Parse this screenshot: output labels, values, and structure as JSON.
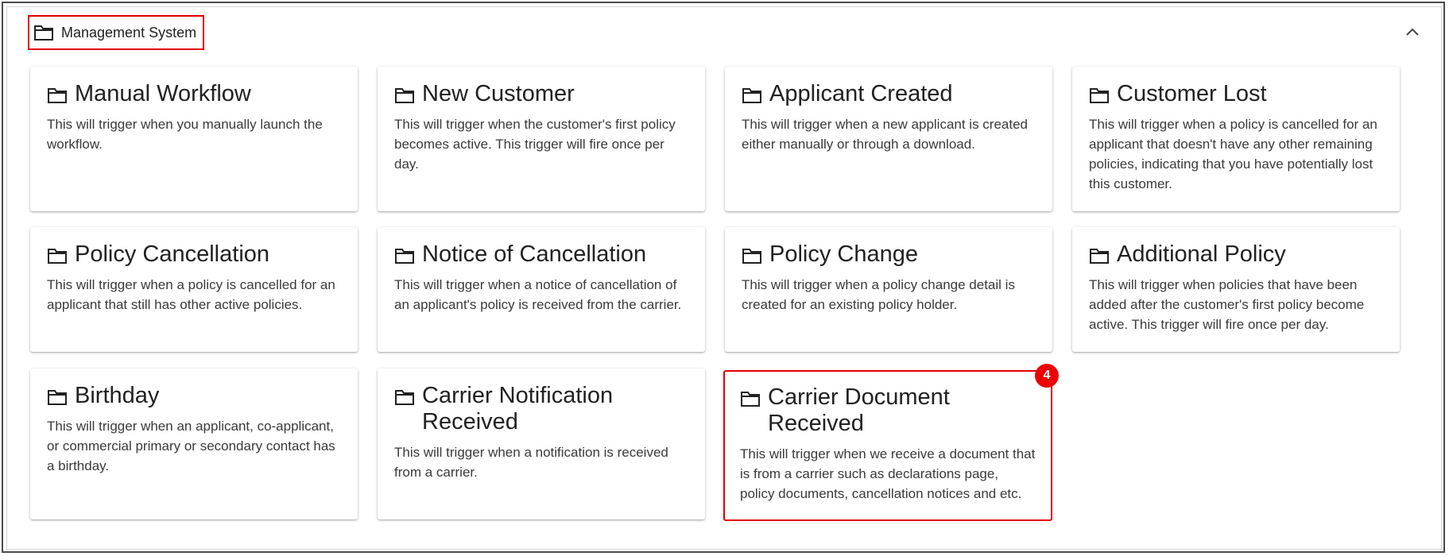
{
  "section": {
    "title": "Management System",
    "icon": "folder-icon",
    "collapse_icon": "chevron-up-icon"
  },
  "cards": [
    {
      "title": "Manual Workflow",
      "description": "This will trigger when you manually launch the workflow."
    },
    {
      "title": "New Customer",
      "description": "This will trigger when the customer's first policy becomes active. This trigger will fire once per day."
    },
    {
      "title": "Applicant Created",
      "description": "This will trigger when a new applicant is created either manually or through a download."
    },
    {
      "title": "Customer Lost",
      "description": "This will trigger when a policy is cancelled for an applicant that doesn't have any other remaining policies, indicating that you have potentially lost this customer."
    },
    {
      "title": "Policy Cancellation",
      "description": "This will trigger when a policy is cancelled for an applicant that still has other active policies."
    },
    {
      "title": "Notice of Cancellation",
      "description": "This will trigger when a notice of cancellation of an applicant's policy is received from the carrier."
    },
    {
      "title": "Policy Change",
      "description": "This will trigger when a policy change detail is created for an existing policy holder."
    },
    {
      "title": "Additional Policy",
      "description": "This will trigger when policies that have been added after the customer's first policy become active. This trigger will fire once per day."
    },
    {
      "title": "Birthday",
      "description": "This will trigger when an applicant, co-applicant, or commercial primary or secondary contact has a birthday."
    },
    {
      "title": "Carrier Notification Received",
      "description": "This will trigger when a notification is received from a carrier."
    },
    {
      "title": "Carrier Document Received",
      "description": "This will trigger when we receive a document that is from a carrier such as declarations page, policy documents, cancellation notices and etc."
    }
  ],
  "badge": {
    "count": "4"
  },
  "colors": {
    "highlight": "#e30000",
    "badge": "#ee0000"
  }
}
